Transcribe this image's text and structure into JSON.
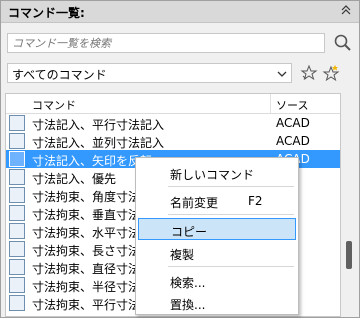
{
  "panel": {
    "title": "コマンド一覧:",
    "collapse_icon": "double-chevron-up"
  },
  "search": {
    "placeholder": "コマンド一覧を検索"
  },
  "filter": {
    "selected": "すべてのコマンド"
  },
  "list": {
    "columns": {
      "command": "コマンド",
      "source": "ソース"
    },
    "rows": [
      {
        "name": "寸法記入、平行寸法記入",
        "source": "ACAD"
      },
      {
        "name": "寸法記入、並列寸法記入",
        "source": "ACAD"
      },
      {
        "name": "寸法記入、矢印を反転",
        "source": "ACAD",
        "selected": true
      },
      {
        "name": "寸法記入、優先",
        "source": ""
      },
      {
        "name": "寸法拘束、角度寸法",
        "source": ""
      },
      {
        "name": "寸法拘束、垂直寸法",
        "source": ""
      },
      {
        "name": "寸法拘束、水平寸法",
        "source": ""
      },
      {
        "name": "寸法拘束、長さ寸法",
        "source": ""
      },
      {
        "name": "寸法拘束、直径寸法",
        "source": ""
      },
      {
        "name": "寸法拘束、半径寸法",
        "source": ""
      },
      {
        "name": "寸法拘束、平行寸法",
        "source": ""
      }
    ]
  },
  "context_menu": {
    "new_command": "新しいコマンド",
    "rename": "名前変更",
    "rename_shortcut": "F2",
    "copy": "コピー",
    "duplicate": "複製",
    "search": "検索...",
    "replace": "置換..."
  },
  "colors": {
    "selection": "#3399ff",
    "menu_highlight": "#cce4f7"
  }
}
